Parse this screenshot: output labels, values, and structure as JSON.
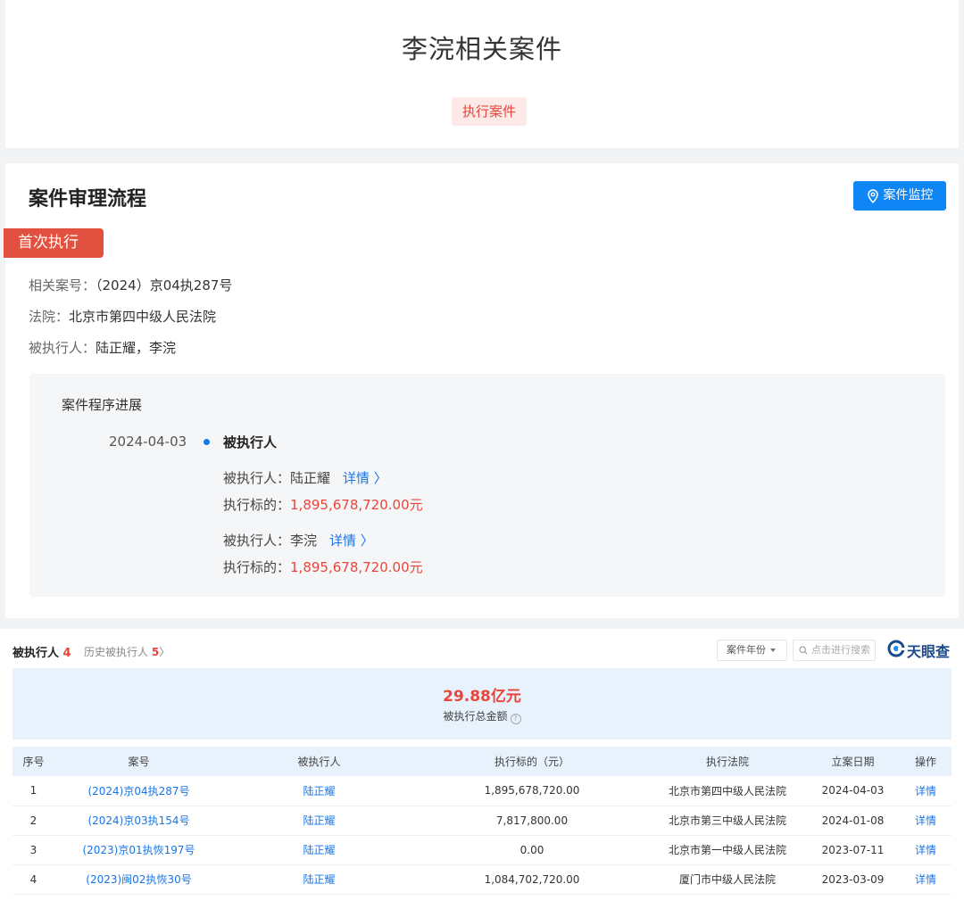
{
  "header": {
    "title": "李浣相关案件",
    "tab": "执行案件"
  },
  "process": {
    "title": "案件审理流程",
    "monitor_button": "案件监控",
    "monitor_icon": "location-pin-icon",
    "stage": "首次执行",
    "case_no_label": "相关案号：",
    "case_no": "（2024）京04执287号",
    "court_label": "法院：",
    "court": "北京市第四中级人民法院",
    "executed_label": "被执行人：",
    "executed": "陆正耀，李浣",
    "progress": {
      "title": "案件程序进展",
      "date": "2024-04-03",
      "event": "被执行人",
      "entries": [
        {
          "person_label": "被执行人：",
          "person": "陆正耀",
          "detail_link": "详情 〉",
          "amount_label": "执行标的：",
          "amount": "1,895,678,720.00元"
        },
        {
          "person_label": "被执行人：",
          "person": "李浣",
          "detail_link": "详情 〉",
          "amount_label": "执行标的：",
          "amount": "1,895,678,720.00元"
        }
      ]
    }
  },
  "bottom": {
    "tab_active": "被执行人",
    "tab_active_count": "4",
    "tab_history": "历史被执行人",
    "tab_history_count": "5",
    "tab_history_arrow": "〉",
    "year_select": "案件年份",
    "search_placeholder": "点击进行搜索",
    "logo_text": "天眼查",
    "summary_value": "29.88亿元",
    "summary_label": "被执行总金额",
    "summary_help": "?",
    "table": {
      "headers": [
        "序号",
        "案号",
        "被执行人",
        "执行标的（元）",
        "执行法院",
        "立案日期",
        "操作"
      ],
      "rows": [
        [
          "1",
          "(2024)京04执287号",
          "陆正耀",
          "1,895,678,720.00",
          "北京市第四中级人民法院",
          "2024-04-03",
          "详情"
        ],
        [
          "2",
          "(2024)京03执154号",
          "陆正耀",
          "7,817,800.00",
          "北京市第三中级人民法院",
          "2024-01-08",
          "详情"
        ],
        [
          "3",
          "(2023)京01执恢197号",
          "陆正耀",
          "0.00",
          "北京市第一中级人民法院",
          "2023-07-11",
          "详情"
        ],
        [
          "4",
          "(2023)闽02执恢30号",
          "陆正耀",
          "1,084,702,720.00",
          "厦门市中级人民法院",
          "2023-03-09",
          "详情"
        ]
      ]
    }
  },
  "colors": {
    "accent_red": "#e9453a",
    "primary_blue": "#0f86f5",
    "link_blue": "#1976e8",
    "badge_red": "#e2513f",
    "summary_bg": "#e8f2fd"
  }
}
